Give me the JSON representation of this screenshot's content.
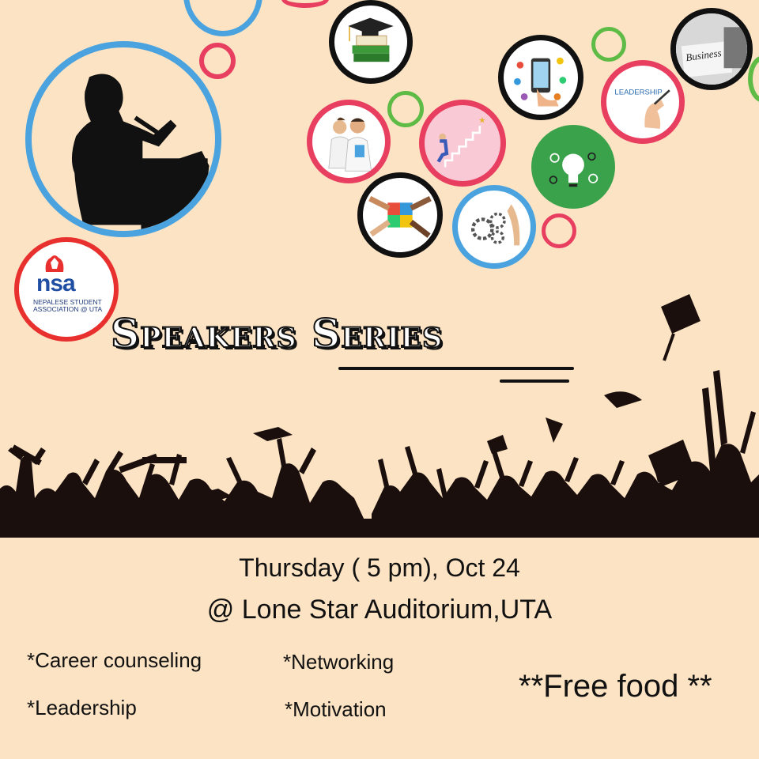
{
  "logo": {
    "abbr": "nsa",
    "subtitle": "Nepalese Student Association @ UTA"
  },
  "bubble_labels": {
    "business": "Business",
    "leadership": "LEADERSHIP"
  },
  "title": "Speakers Series",
  "event": {
    "date_line": "Thursday ( 5 pm), Oct 24",
    "venue_line": "@ Lone Star Auditorium,UTA"
  },
  "topics": [
    "*Career counseling",
    "*Networking",
    "*Leadership",
    "*Motivation"
  ],
  "food_note": "**Free food **",
  "colors": {
    "background": "#fce3c3",
    "ring_blue": "#4aa3df",
    "ring_pink": "#e83e5f",
    "ring_green": "#5dbb46",
    "ring_black": "#111111",
    "logo_red": "#e8312f",
    "logo_blue": "#1f4ea3"
  }
}
